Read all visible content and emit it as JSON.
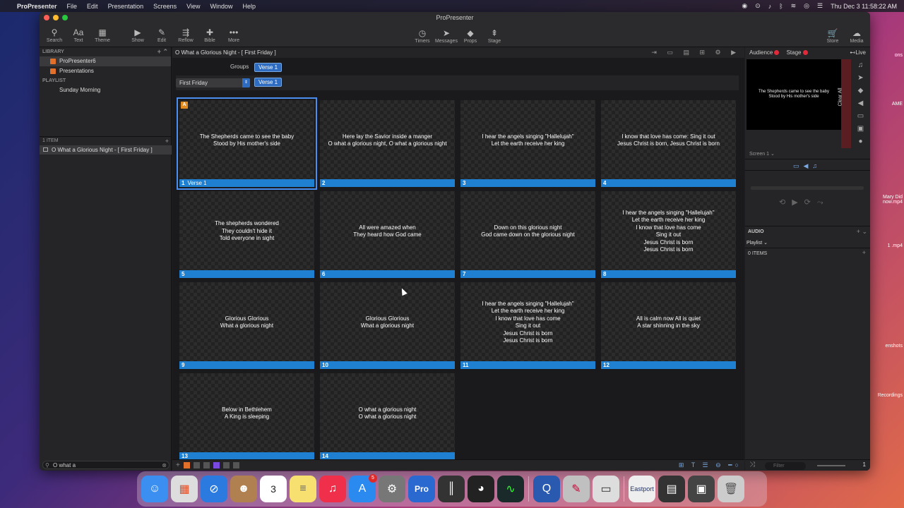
{
  "menubar": {
    "app_name": "ProPresenter",
    "items": [
      "File",
      "Edit",
      "Presentation",
      "Screens",
      "View",
      "Window",
      "Help"
    ],
    "clock": "Thu Dec 3  11:58:22 AM"
  },
  "window": {
    "title": "ProPresenter",
    "traffic_colors": [
      "#ff5f57",
      "#febc2e",
      "#28c840"
    ]
  },
  "toolbar": {
    "left": [
      {
        "label": "Search",
        "icon": "search-icon",
        "glyph": "⚲"
      },
      {
        "label": "Text",
        "icon": "text-icon",
        "glyph": "Aa"
      },
      {
        "label": "Theme",
        "icon": "theme-icon",
        "glyph": "▦"
      },
      {
        "label": "Show",
        "icon": "play-icon",
        "glyph": "▶"
      },
      {
        "label": "Edit",
        "icon": "pencil-icon",
        "glyph": "✎"
      },
      {
        "label": "Reflow",
        "icon": "reflow-icon",
        "glyph": "⇶"
      },
      {
        "label": "Bible",
        "icon": "bible-icon",
        "glyph": "✚"
      },
      {
        "label": "More",
        "icon": "more-icon",
        "glyph": "•••"
      }
    ],
    "center": [
      {
        "label": "Timers",
        "icon": "timer-icon",
        "glyph": "◷"
      },
      {
        "label": "Messages",
        "icon": "messages-icon",
        "glyph": "➤"
      },
      {
        "label": "Props",
        "icon": "props-icon",
        "glyph": "◆"
      },
      {
        "label": "Stage",
        "icon": "stage-icon",
        "glyph": "⇞"
      }
    ],
    "right": [
      {
        "label": "Store",
        "icon": "store-icon",
        "glyph": "🛒"
      },
      {
        "label": "Media",
        "icon": "media-icon",
        "glyph": "☁"
      }
    ]
  },
  "sidebar": {
    "library_header": "LIBRARY",
    "library_items": [
      "ProPresenter6",
      "Presentations"
    ],
    "playlist_header": "PLAYLIST",
    "playlist_items": [
      "Sunday Morning"
    ],
    "items_count": "1 ITEM",
    "playlist_entry": "O What a Glorious Night - [ First Friday ]",
    "filter_value": "O what a"
  },
  "main": {
    "header_title": "O What a Glorious Night - [ First Friday ]",
    "groups_label": "Groups",
    "group_button": "Verse 1",
    "arrangement": "First Friday",
    "arrangement_group": "Verse 1",
    "selected_slide": 1,
    "slides": [
      {
        "num": "1",
        "group": "Verse 1",
        "text": "The Shepherds came to see the baby\nStood by His mother's side"
      },
      {
        "num": "2",
        "group": "",
        "text": "Here lay the Savior inside a manger\nO what a glorious night, O what a glorious night"
      },
      {
        "num": "3",
        "group": "",
        "text": "I hear the angels singing \"Hallelujah\"\nLet the earth receive her king"
      },
      {
        "num": "4",
        "group": "",
        "text": "I know that love has come: Sing it out\nJesus Christ is born, Jesus Christ is born"
      },
      {
        "num": "5",
        "group": "",
        "text": "The shepherds wondered\nThey couldn't hide it\nTold everyone in sight"
      },
      {
        "num": "6",
        "group": "",
        "text": "All were amazed when\nThey heard how God came"
      },
      {
        "num": "7",
        "group": "",
        "text": "Down on this glorious night\nGod came down on the glorious night"
      },
      {
        "num": "8",
        "group": "",
        "text": "I hear the angels singing \"Hallelujah\"\nLet the earth receive her king\nI know that love has come\nSing it out\nJesus Christ is born\nJesus Christ is born"
      },
      {
        "num": "9",
        "group": "",
        "text": "Glorious Glorious\nWhat a glorious night"
      },
      {
        "num": "10",
        "group": "",
        "text": "Glorious Glorious\nWhat a glorious night"
      },
      {
        "num": "11",
        "group": "",
        "text": "I hear the angels singing \"Hallelujah\"\nLet the earth receive her king\nI know that love has come\nSing it out\nJesus Christ is born\nJesus Christ is born"
      },
      {
        "num": "12",
        "group": "",
        "text": "All is calm now All is quiet\nA star shinning in the sky"
      },
      {
        "num": "13",
        "group": "",
        "text": "Below in Bethlehem\nA King is sleeping"
      },
      {
        "num": "14",
        "group": "",
        "text": "O what a glorious night\nO what a glorious night"
      }
    ],
    "label_color": "#1f7fd0"
  },
  "right_panel": {
    "audience_label": "Audience",
    "stage_label": "Stage",
    "live_label": "Live",
    "preview_text": "The Shepherds came to see the baby\nStood by His mother's side",
    "clear_all": "Clear All",
    "screen_label": "Screen 1",
    "audio_header": "AUDIO",
    "playlist_dropdown": "Playlist",
    "items_count": "0 ITEMS",
    "filter_placeholder": "Filter",
    "page_num": "1"
  },
  "desktop": {
    "items": [
      "ons",
      "AME",
      "Mary Did\nnow.mp4",
      "1 .mp4",
      "enshots",
      "Recordings"
    ]
  }
}
